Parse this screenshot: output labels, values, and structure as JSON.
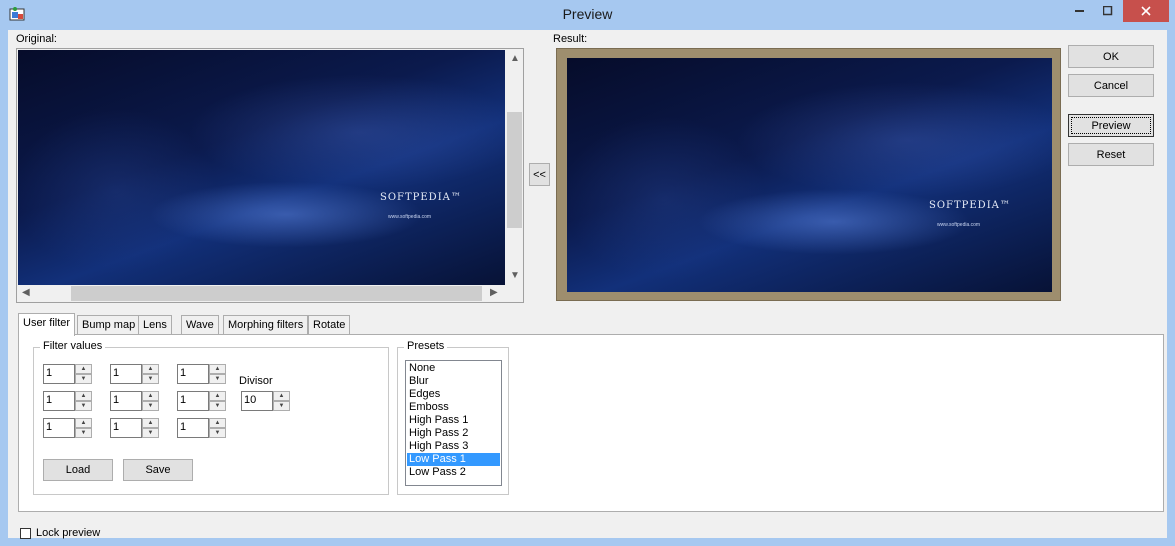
{
  "window": {
    "title": "Preview"
  },
  "captions": {
    "original": "Original:",
    "result": "Result:"
  },
  "image": {
    "logo": "SOFTPEDIA™",
    "url": "www.softpedia.com"
  },
  "buttons": {
    "ok": "OK",
    "cancel": "Cancel",
    "preview": "Preview",
    "reset": "Reset",
    "copy": "<<",
    "load": "Load",
    "save": "Save"
  },
  "tabs": [
    "User filter",
    "Bump map",
    "Lens",
    "Wave",
    "Morphing filters",
    "Rotate"
  ],
  "filter": {
    "title": "Filter values",
    "values": [
      "1",
      "1",
      "1",
      "1",
      "1",
      "1",
      "1",
      "1",
      "1"
    ],
    "divisor_label": "Divisor",
    "divisor": "10"
  },
  "presets": {
    "title": "Presets",
    "items": [
      "None",
      "Blur",
      "Edges",
      "Emboss",
      "High Pass 1",
      "High Pass 2",
      "High Pass 3",
      "Low Pass 1",
      "Low Pass 2"
    ],
    "selected": "Low Pass 1"
  },
  "lock": {
    "label": "Lock preview",
    "checked": false
  },
  "colors": {
    "titlebar": "#a6c8f0",
    "close": "#c7504c",
    "selection": "#3399ff",
    "result_border": "#9e8e6e"
  }
}
